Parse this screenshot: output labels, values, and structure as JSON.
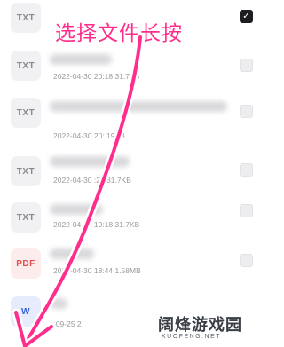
{
  "annotation_text": "选择文件长按",
  "files": [
    {
      "icon": "TXT",
      "kind": "txt",
      "meta": "",
      "checked": true
    },
    {
      "icon": "TXT",
      "kind": "txt",
      "meta": "2022-04-30 20:18 31.7KB",
      "checked": false
    },
    {
      "icon": "TXT",
      "kind": "txt",
      "meta": "2022-04-30 20: 19KB",
      "checked": false
    },
    {
      "icon": "TXT",
      "kind": "txt",
      "meta": "2022-04-30 :21 31.7KB",
      "checked": false
    },
    {
      "icon": "TXT",
      "kind": "txt",
      "meta": "2022-04-30 19:18 31.7KB",
      "checked": false
    },
    {
      "icon": "PDF",
      "kind": "pdf",
      "meta": "2022-04-30 18:44 1.58MB",
      "checked": false
    },
    {
      "icon": "W",
      "kind": "doc",
      "meta": "-09-25 2",
      "checked": false
    }
  ],
  "watermark": {
    "title": "阔烽游戏园",
    "subtitle": "KUOFENG.NET"
  },
  "colors": {
    "annotation": "#ff2d8c",
    "checked_box": "#1e1e22"
  }
}
